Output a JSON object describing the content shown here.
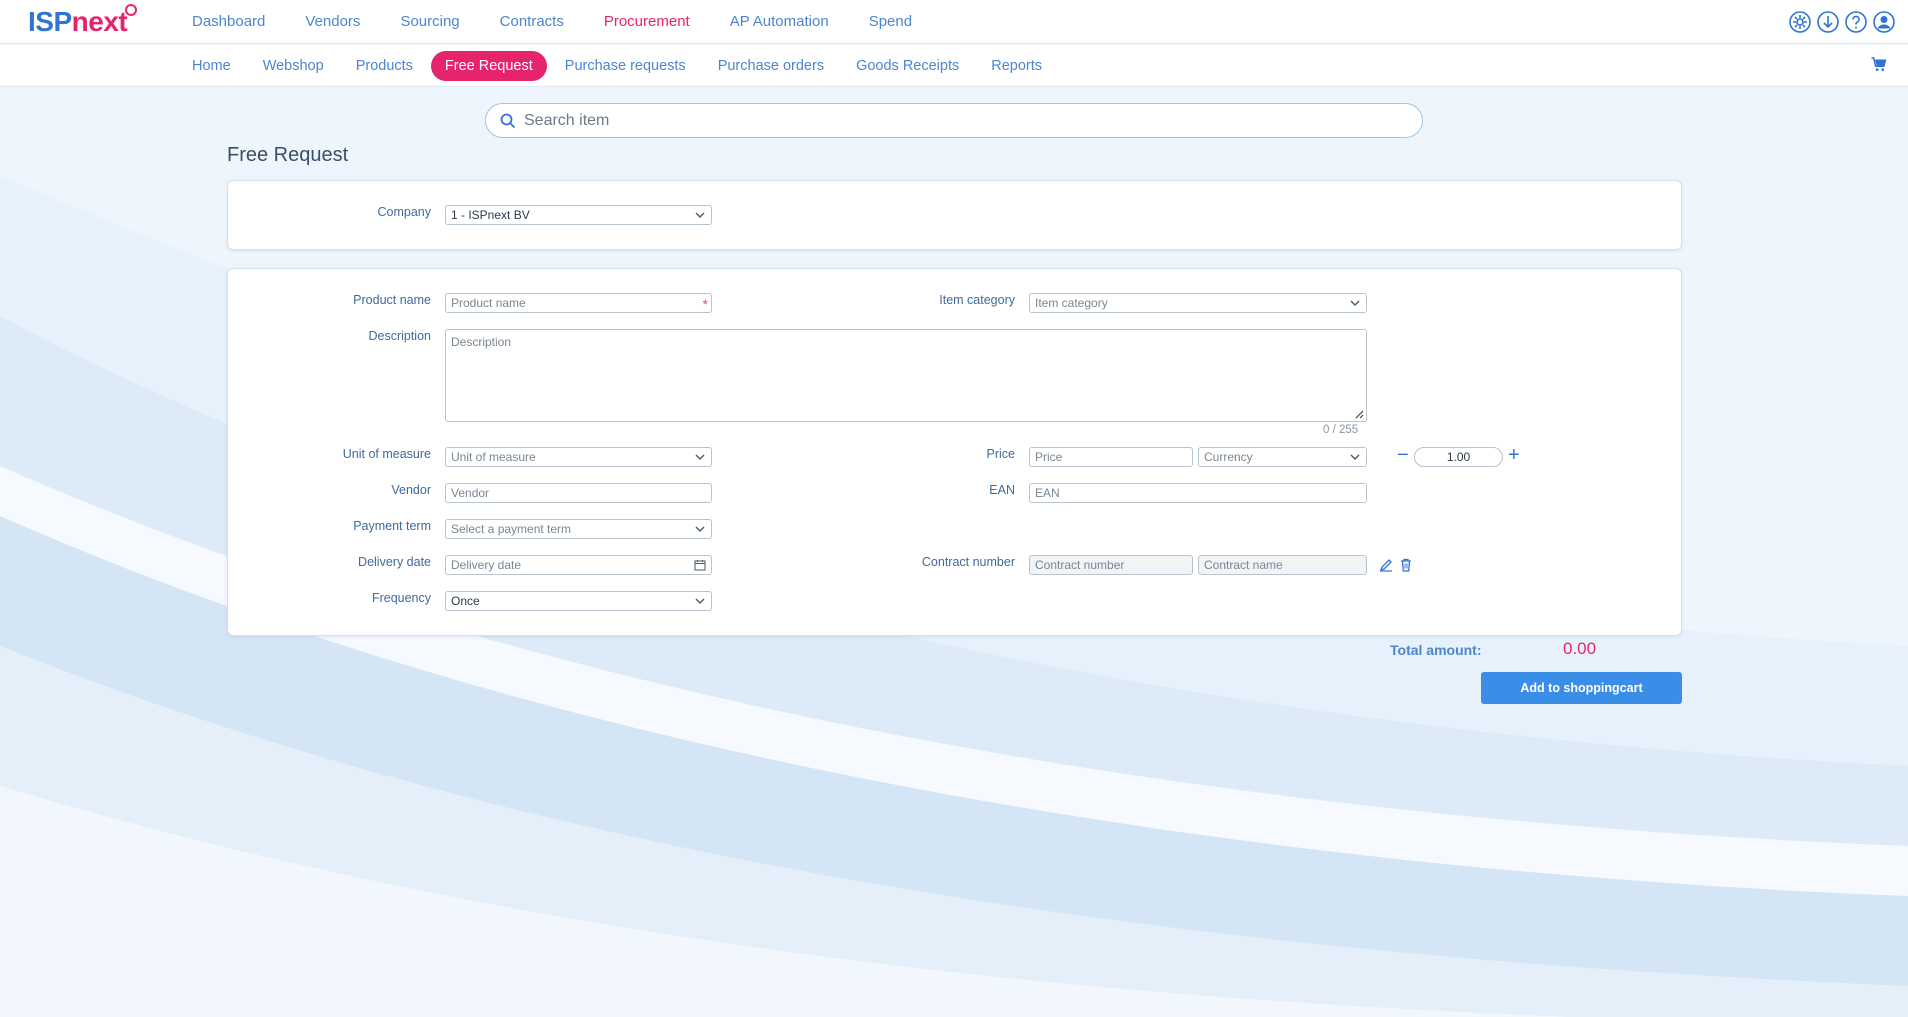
{
  "brand": {
    "logo_part1": "ISP",
    "logo_part2": "next"
  },
  "main_nav": [
    {
      "label": "Dashboard"
    },
    {
      "label": "Vendors"
    },
    {
      "label": "Sourcing"
    },
    {
      "label": "Contracts"
    },
    {
      "label": "Procurement",
      "active": true
    },
    {
      "label": "AP Automation"
    },
    {
      "label": "Spend"
    }
  ],
  "top_icons": [
    "settings-icon",
    "download-icon",
    "help-icon",
    "user-icon"
  ],
  "sub_nav": [
    {
      "label": "Home"
    },
    {
      "label": "Webshop"
    },
    {
      "label": "Products"
    },
    {
      "label": "Free Request",
      "active": true
    },
    {
      "label": "Purchase requests"
    },
    {
      "label": "Purchase orders"
    },
    {
      "label": "Goods Receipts"
    },
    {
      "label": "Reports"
    }
  ],
  "search": {
    "placeholder": "Search item"
  },
  "page_title": "Free Request",
  "company": {
    "label": "Company",
    "value": "1 - ISPnext BV"
  },
  "form": {
    "product_name": {
      "label": "Product name",
      "placeholder": "Product name",
      "required_mark": "*"
    },
    "item_category": {
      "label": "Item category",
      "placeholder": "Item category"
    },
    "description": {
      "label": "Description",
      "placeholder": "Description",
      "counter": "0 / 255"
    },
    "unit_of_measure": {
      "label": "Unit of measure",
      "placeholder": "Unit of measure"
    },
    "price": {
      "label": "Price",
      "placeholder": "Price",
      "currency_placeholder": "Currency"
    },
    "quantity": {
      "value": "1.00",
      "minus": "−",
      "plus": "+"
    },
    "vendor": {
      "label": "Vendor",
      "placeholder": "Vendor"
    },
    "ean": {
      "label": "EAN",
      "placeholder": "EAN"
    },
    "payment_term": {
      "label": "Payment term",
      "placeholder": "Select a payment term"
    },
    "delivery_date": {
      "label": "Delivery date",
      "placeholder": "Delivery date"
    },
    "contract": {
      "label": "Contract number",
      "number_placeholder": "Contract number",
      "name_placeholder": "Contract name"
    },
    "frequency": {
      "label": "Frequency",
      "value": "Once"
    }
  },
  "total": {
    "label": "Total amount:",
    "value": "0.00"
  },
  "add_button": "Add to shoppingcart",
  "colors": {
    "accent": "#e6246e",
    "primary": "#2f74d0",
    "button": "#3b8ee8"
  }
}
